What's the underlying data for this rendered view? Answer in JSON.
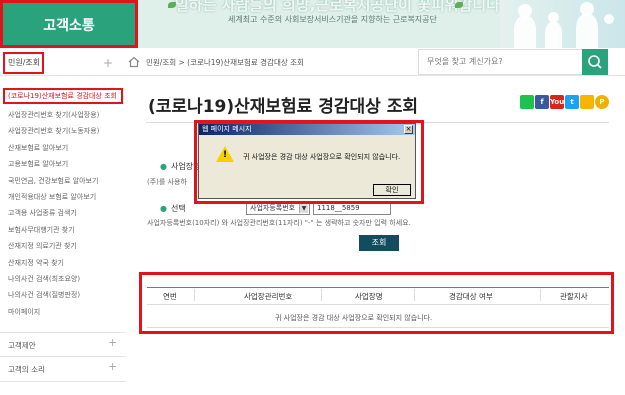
{
  "header": {
    "logo_text": "고객소통",
    "banner_title": "일하는 사람들의 희망,근로복지공단이 꽃피워갑니다",
    "banner_subtitle": "세계최고 수준의 사회보장서비스기관을 지향하는 근로복지공단"
  },
  "nav": {
    "menu_select": "민원/조회",
    "breadcrumb": "민원/조회  >  (코로나19)산재보험료 경감대상 조회",
    "search_placeholder": "무엇을 찾고 계신가요?"
  },
  "sidebar": {
    "active_item": "(코로나19)산재보험료 경감대상 조회",
    "items": [
      "사업장관리번호 찾기(사업장용)",
      "사업장관리번호 찾기(노동자용)",
      "산재보험료 알아보기",
      "고용보험료 알아보기",
      "국민연금, 건강보험료 알아보기",
      "개인적용대상 보험료 알아보기",
      "고객용 사업종류 검색기",
      "보험사무대행기관 찾기",
      "산재지정 의료기관 찾기",
      "산재지정 약국 찾기",
      "나의사건 검색(최초요양)",
      "나의사건 검색(질병판정)",
      "마이페이지"
    ],
    "sections": [
      "고객제안",
      "고객의 소리"
    ]
  },
  "main": {
    "title": "(코로나19)산재보험료 경감대상 조회",
    "sns": [
      {
        "name": "naver-blog-icon",
        "color": "#20c14f",
        "glyph": ""
      },
      {
        "name": "facebook-icon",
        "color": "#3b5998",
        "glyph": "f"
      },
      {
        "name": "youtube-icon",
        "color": "#d9261c",
        "glyph": "You"
      },
      {
        "name": "twitter-icon",
        "color": "#1da1f2",
        "glyph": "t"
      },
      {
        "name": "kakaostory-icon",
        "color": "#f7b500",
        "glyph": ""
      },
      {
        "name": "kakao-icon",
        "color": "#f0b000",
        "glyph": "P"
      }
    ],
    "label_company": "사업장명",
    "note_company": "(주)를 사용하",
    "label_select": "선택",
    "select_value": "사업자등록번호",
    "input_value": "1118__5859",
    "note_format": "사업자등록번호(10자리) 와 사업장관리번호(11자리) \"-\" 는 생략하고 숫자만 입력 하세요.",
    "query_button": "조회"
  },
  "dialog": {
    "title": "웹 페이지 메시지",
    "close": "×",
    "message": "귀 사업장은 경감 대상 사업장으로 확인되지 않습니다.",
    "ok": "확인"
  },
  "table": {
    "headers": [
      "연번",
      "사업장관리번호",
      "사업장명",
      "경감대상 여부",
      "관할지사"
    ],
    "empty_message": "귀 사업장은 경감 대상 사업장으로 확인되지 않습니다."
  },
  "colors": {
    "accent": "#2aa37c",
    "highlight": "#e0141b",
    "button_dark": "#114d5e"
  }
}
